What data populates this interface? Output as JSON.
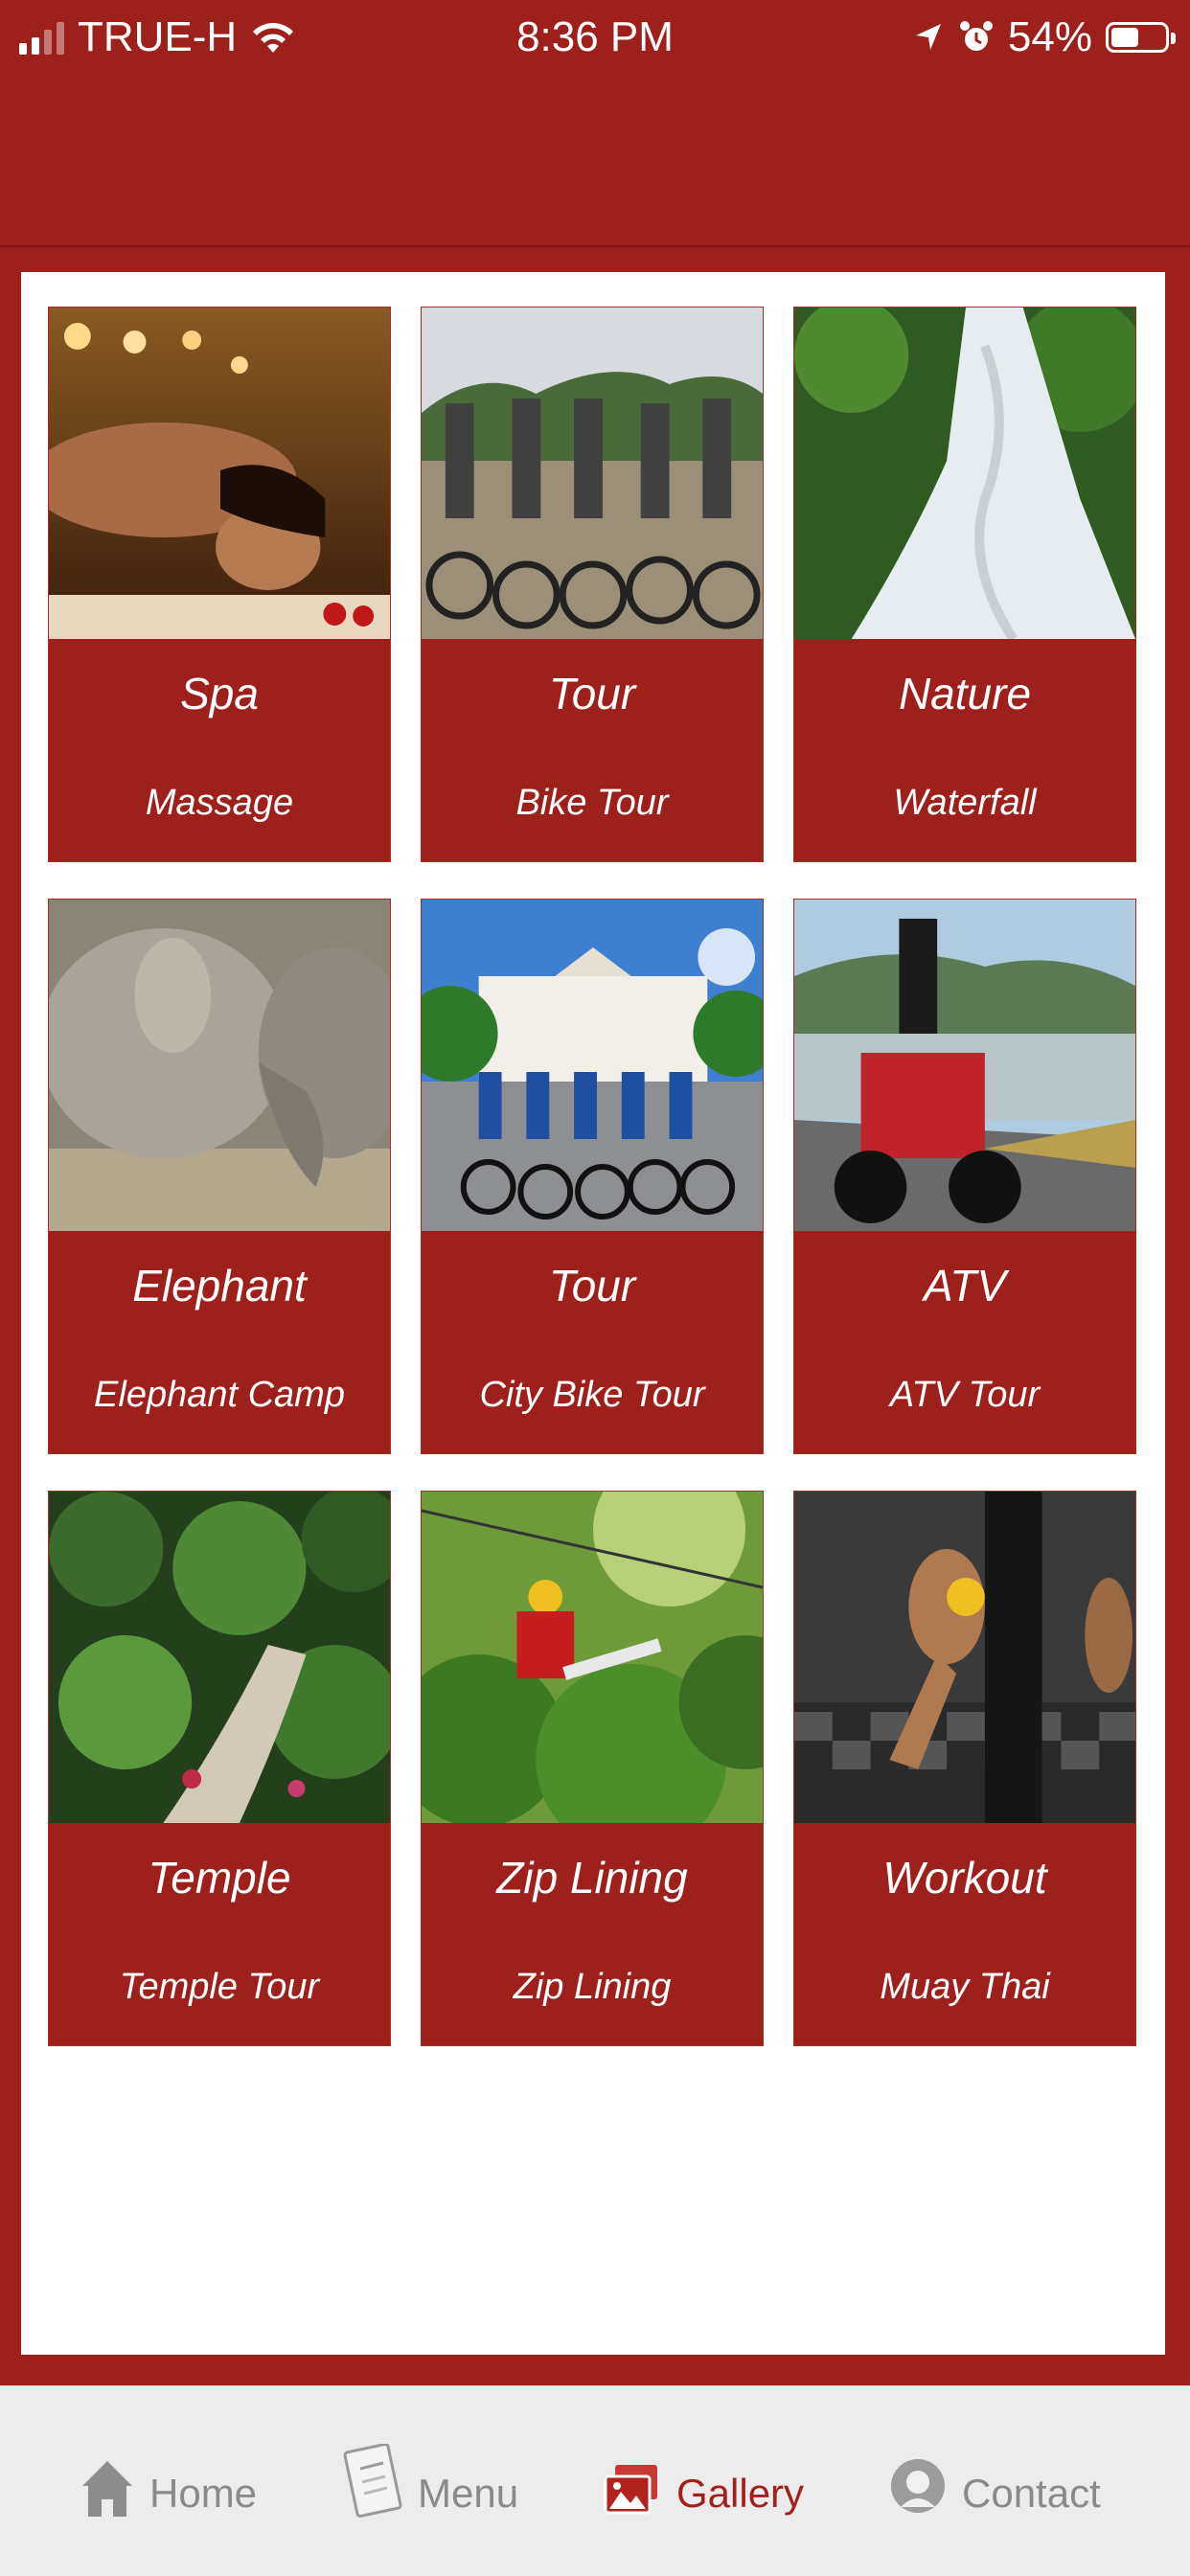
{
  "status_bar": {
    "carrier": "TRUE-H",
    "time": "8:36 PM",
    "battery": "54%",
    "battery_level": 0.54
  },
  "gallery": {
    "tiles": [
      {
        "title": "Spa",
        "subtitle": "Massage",
        "image": "spa-massage-photo"
      },
      {
        "title": "Tour",
        "subtitle": "Bike Tour",
        "image": "bike-tour-group-photo"
      },
      {
        "title": "Nature",
        "subtitle": "Waterfall",
        "image": "waterfall-photo"
      },
      {
        "title": "Elephant",
        "subtitle": "Elephant Camp",
        "image": "elephants-photo"
      },
      {
        "title": "Tour",
        "subtitle": "City Bike Tour",
        "image": "city-bike-tour-photo"
      },
      {
        "title": "ATV",
        "subtitle": "ATV Tour",
        "image": "atv-photo"
      },
      {
        "title": "Temple",
        "subtitle": "Temple Tour",
        "image": "temple-garden-photo"
      },
      {
        "title": "Zip Lining",
        "subtitle": "Zip Lining",
        "image": "zipline-photo"
      },
      {
        "title": "Workout",
        "subtitle": "Muay Thai",
        "image": "muay-thai-photo"
      }
    ]
  },
  "tab_bar": {
    "tabs": [
      {
        "label": "Home",
        "icon": "home-icon",
        "active": false
      },
      {
        "label": "Menu",
        "icon": "menu-icon",
        "active": false
      },
      {
        "label": "Gallery",
        "icon": "gallery-icon",
        "active": true
      },
      {
        "label": "Contact",
        "icon": "contact-icon",
        "active": false
      }
    ]
  },
  "colors": {
    "brand_red": "#9e201b",
    "tab_bar_bg": "#ececec",
    "active_tab": "#a3211c",
    "inactive_tab": "#8a8a8a"
  }
}
